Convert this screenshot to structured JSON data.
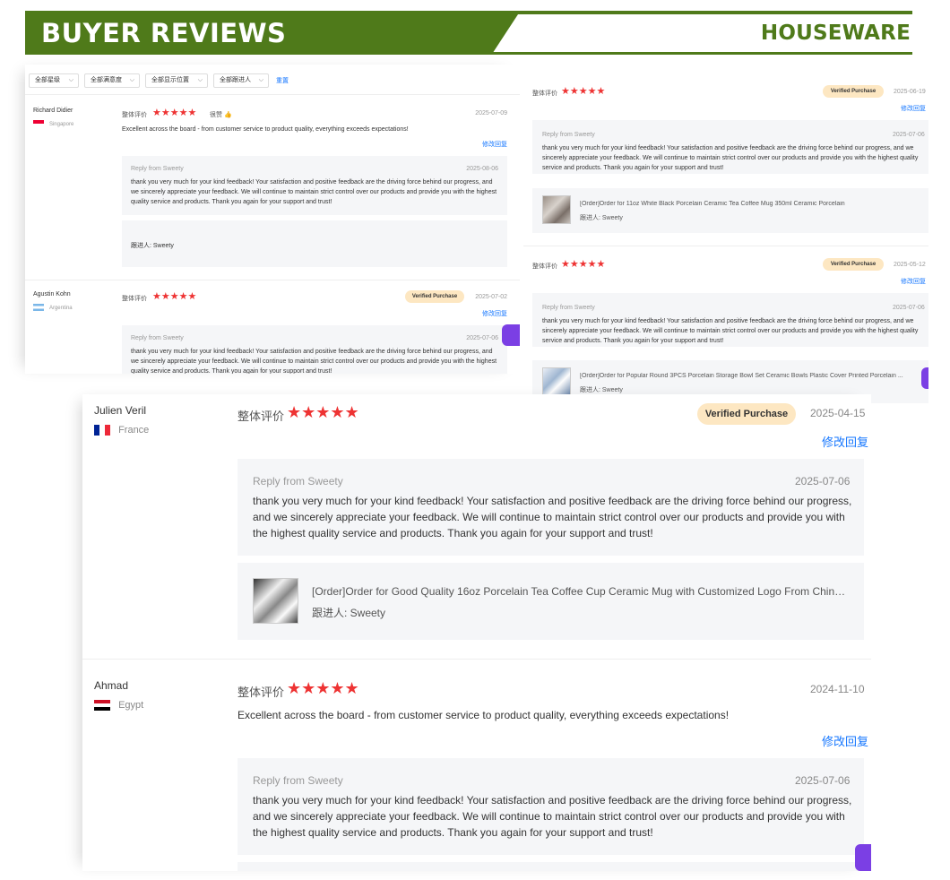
{
  "banner": {
    "title": "BUYER REVIEWS",
    "category": "HOUSEWARE"
  },
  "panel_a": {
    "filters": [
      {
        "label": "全部星级"
      },
      {
        "label": "全部满意度"
      },
      {
        "label": "全部显示位置"
      },
      {
        "label": "全部跟进人"
      }
    ],
    "reset_label": "重置",
    "reviews": [
      {
        "name": "Richard Didier",
        "country": "Singapore",
        "rating_label": "整体评价",
        "stars": "★★★★★",
        "rating_text": "很赞",
        "date": "2025-07-09",
        "comment": "Excellent across the board - from customer service to product quality, everything exceeds expectations!",
        "edit_reply": "修改回复",
        "reply_from": "Reply from Sweety",
        "reply_date": "2025-08-06",
        "reply_text": "thank you very much for your kind feedback! Your satisfaction and positive feedback are the driving force behind our progress, and we sincerely appreciate your feedback. We will continue to maintain strict control over our products and provide you with the highest quality service and products. Thank you again for your support and trust!",
        "follower": "跟进人: Sweety"
      },
      {
        "name": "Agustin Kohn",
        "country": "Argentina",
        "rating_label": "整体评价",
        "stars": "★★★★★",
        "badge": "Verified Purchase",
        "date": "2025-07-02",
        "edit_reply": "修改回复",
        "reply_from": "Reply from Sweety",
        "reply_date": "2025-07-06",
        "reply_text": "thank you very much for your kind feedback! Your satisfaction and positive feedback are the driving force behind our progress, and we sincerely appreciate your feedback. We will continue to maintain strict control over our products and provide you with the highest quality service and products. Thank you again for your support and trust!"
      }
    ]
  },
  "panel_b": {
    "reviews": [
      {
        "rating_label": "整体评价",
        "stars": "★★★★★",
        "badge": "Verified Purchase",
        "date": "2025-06-19",
        "edit_reply": "修改回复",
        "reply_from": "Reply from Sweety",
        "reply_date": "2025-07-06",
        "reply_text": "thank you very much for your kind feedback! Your satisfaction and positive feedback are the driving force behind our progress, and we sincerely appreciate your feedback. We will continue to maintain strict control over our products and provide you with the highest quality service and products. Thank you again for your support and trust!",
        "order": "[Order]Order for 11oz White Black Porcelain Ceramic Tea Coffee Mug 350ml Ceramic Porcelain",
        "follower": "跟进人: Sweety"
      },
      {
        "rating_label": "整体评价",
        "stars": "★★★★★",
        "badge": "Verified Purchase",
        "date": "2025-05-12",
        "edit_reply": "修改回复",
        "reply_from": "Reply from Sweety",
        "reply_date": "2025-07-06",
        "reply_text": "thank you very much for your kind feedback! Your satisfaction and positive feedback are the driving force behind our progress, and we sincerely appreciate your feedback. We will continue to maintain strict control over our products and provide you with the highest quality service and products. Thank you again for your support and trust!",
        "order": "[Order]Order for Popular Round 3PCS Porcelain Storage Bowl Set Ceramic Bowls Plastic Cover Printed Porcelain ...",
        "follower": "跟进人: Sweety"
      }
    ]
  },
  "panel_c": {
    "reviews": [
      {
        "name": "Julien Veril",
        "country": "France",
        "rating_label": "整体评价",
        "stars": "★★★★★",
        "badge": "Verified Purchase",
        "date": "2025-04-15",
        "edit_reply": "修改回复",
        "reply_from": "Reply from Sweety",
        "reply_date": "2025-07-06",
        "reply_text": "thank you very much for your kind feedback! Your satisfaction and positive feedback are the driving force behind our progress, and we sincerely appreciate your feedback. We will continue to maintain strict control over our products and provide you with the highest quality service and products. Thank you again for your support and trust!",
        "order": "[Order]Order for Good Quality 16oz Porcelain Tea Coffee Cup Ceramic Mug with Customized Logo From China U...",
        "follower": "跟进人: Sweety"
      },
      {
        "name": "Ahmad",
        "country": "Egypt",
        "rating_label": "整体评价",
        "stars": "★★★★★",
        "date": "2024-11-10",
        "comment": "Excellent across the board - from customer service to product quality, everything exceeds expectations!",
        "edit_reply": "修改回复",
        "reply_from": "Reply from Sweety",
        "reply_date": "2025-07-06",
        "reply_text": "thank you very much for your kind feedback! Your satisfaction and positive feedback are the driving force behind our progress, and we sincerely appreciate your feedback. We will continue to maintain strict control over our products and provide you with the highest quality service and products. Thank you again for your support and trust!"
      }
    ]
  },
  "colors": {
    "brand_green": "#4f7a1a",
    "star_red": "#e33333",
    "link_blue": "#1677ff",
    "badge_bg": "#fde7c2"
  }
}
